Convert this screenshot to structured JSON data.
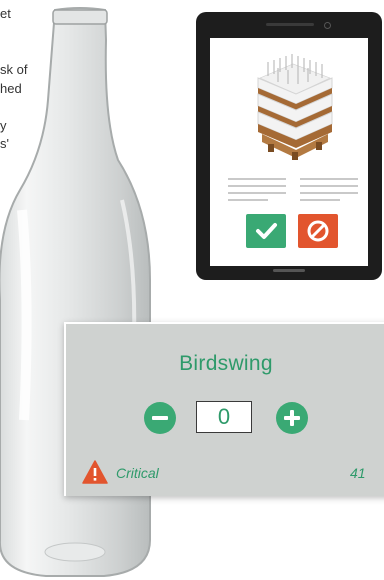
{
  "background_text": {
    "lines": [
      "et",
      "",
      "sk of",
      "hed",
      "",
      "y",
      "s'"
    ]
  },
  "tablet": {
    "action_buttons": [
      {
        "name": "approve",
        "icon": "check-icon",
        "color": "#3aa974"
      },
      {
        "name": "reject",
        "icon": "prohibited-icon",
        "color": "#e2552e"
      }
    ]
  },
  "card": {
    "product_name": "Birdswing",
    "quantity": "0",
    "status_icon": "warning-triangle-icon",
    "status_label": "Critical",
    "count": "41"
  },
  "colors": {
    "accent_green": "#3aa974",
    "text_green": "#2e9a6a",
    "alert_red": "#e2552e",
    "card_bg": "#cfd2d0"
  }
}
